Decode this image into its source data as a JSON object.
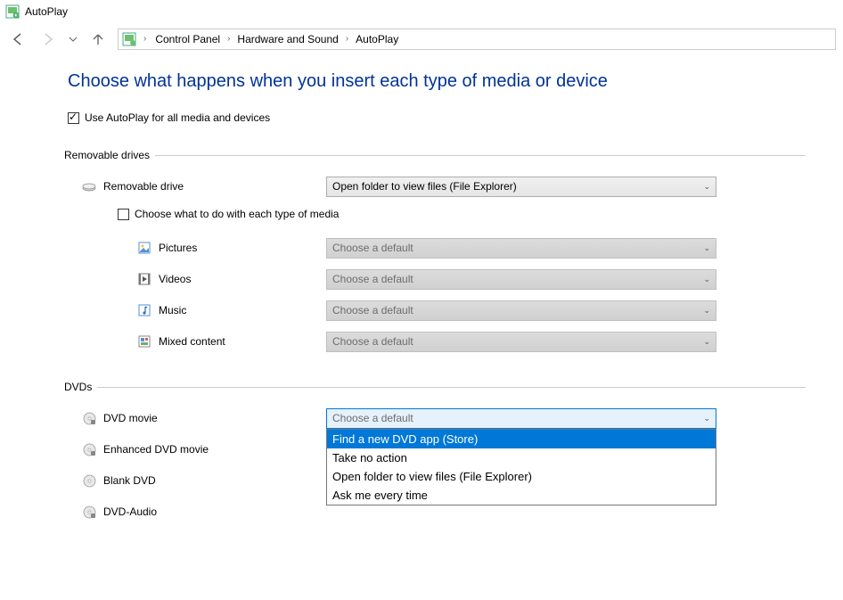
{
  "window": {
    "title": "AutoPlay"
  },
  "breadcrumb": {
    "items": [
      "Control Panel",
      "Hardware and Sound",
      "AutoPlay"
    ]
  },
  "heading": "Choose what happens when you insert each type of media or device",
  "global_checkbox": {
    "label": "Use AutoPlay for all media and devices",
    "checked": true
  },
  "sections": {
    "removable": {
      "title": "Removable drives",
      "drive_label": "Removable drive",
      "drive_value": "Open folder to view files (File Explorer)",
      "subchoice_label": "Choose what to do with each type of media",
      "subchoice_checked": false,
      "media": [
        {
          "label": "Pictures",
          "value": "Choose a default"
        },
        {
          "label": "Videos",
          "value": "Choose a default"
        },
        {
          "label": "Music",
          "value": "Choose a default"
        },
        {
          "label": "Mixed content",
          "value": "Choose a default"
        }
      ]
    },
    "dvds": {
      "title": "DVDs",
      "items": [
        {
          "label": "DVD movie",
          "value": "Choose a default",
          "open": true
        },
        {
          "label": "Enhanced DVD movie",
          "value": ""
        },
        {
          "label": "Blank DVD",
          "value": ""
        },
        {
          "label": "DVD-Audio",
          "value": ""
        }
      ],
      "dropdown_options": [
        "Find a new DVD app (Store)",
        "Take no action",
        "Open folder to view files (File Explorer)",
        "Ask me every time"
      ]
    }
  }
}
